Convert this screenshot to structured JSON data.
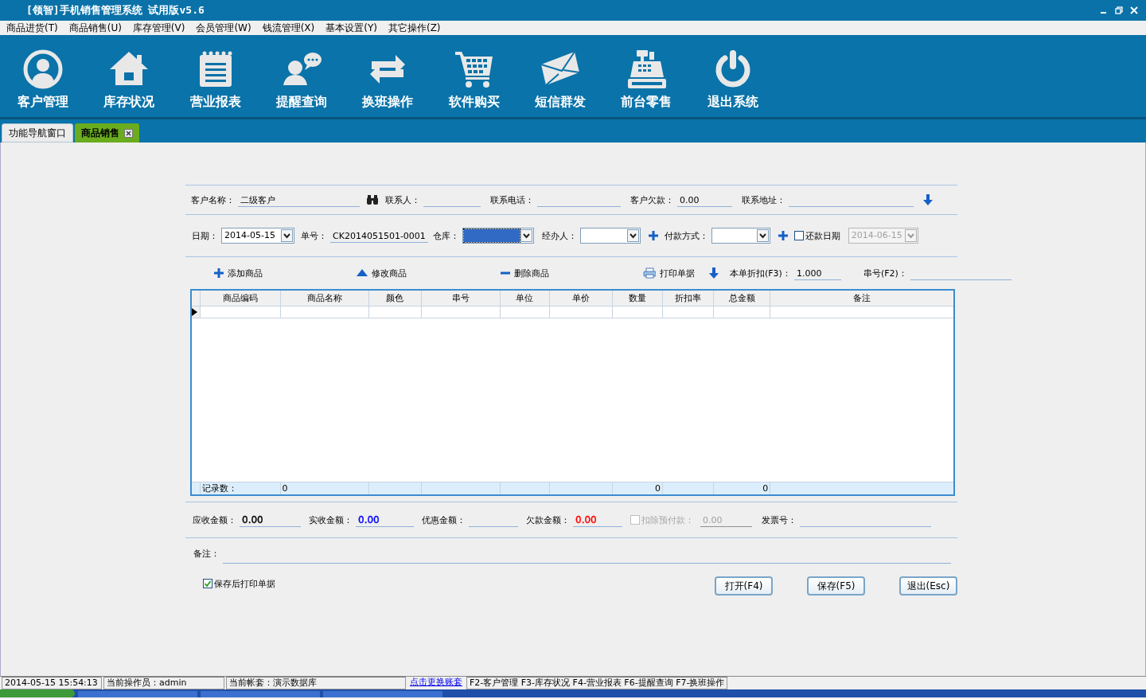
{
  "window": {
    "title": "[领智]手机销售管理系统 试用版v5.6"
  },
  "menu": [
    "商品进货(T)",
    "商品销售(U)",
    "库存管理(V)",
    "会员管理(W)",
    "钱流管理(X)",
    "基本设置(Y)",
    "其它操作(Z)"
  ],
  "toolbar": [
    {
      "label": "客户管理",
      "kind": "person"
    },
    {
      "label": "库存状况",
      "kind": "house"
    },
    {
      "label": "营业报表",
      "kind": "notepad"
    },
    {
      "label": "提醒查询",
      "kind": "chat"
    },
    {
      "label": "换班操作",
      "kind": "swap"
    },
    {
      "label": "软件购买",
      "kind": "cart"
    },
    {
      "label": "短信群发",
      "kind": "mail"
    },
    {
      "label": "前台零售",
      "kind": "register"
    },
    {
      "label": "退出系统",
      "kind": "power"
    }
  ],
  "tabs": [
    {
      "label": "功能导航窗口",
      "selected": false,
      "closable": false
    },
    {
      "label": "商品销售",
      "selected": true,
      "closable": true
    }
  ],
  "header_fields": [
    {
      "kind": "field",
      "label": "客户名称：",
      "value": "二级客户"
    },
    {
      "kind": "find"
    },
    {
      "kind": "field",
      "label": "联系人："
    },
    {
      "kind": "field",
      "label": "联系电话："
    },
    {
      "kind": "field",
      "label": "客户欠款：",
      "value": "0.00"
    },
    {
      "kind": "field",
      "label": "联系地址："
    },
    {
      "kind": "down"
    }
  ],
  "order_fields": [
    {
      "kind": "combo",
      "label": "日期：",
      "value": "2014-05-15",
      "focused": false,
      "disabled": false
    },
    {
      "kind": "field",
      "label": "单号：",
      "value": "CK2014051501-0001"
    },
    {
      "kind": "combo",
      "label": "仓库：",
      "focused": true,
      "disabled": false
    },
    {
      "kind": "combo",
      "label": "经办人：",
      "focused": false,
      "disabled": false
    },
    {
      "kind": "add"
    },
    {
      "kind": "combo",
      "label": "付款方式：",
      "focused": false,
      "disabled": false
    },
    {
      "kind": "add"
    },
    {
      "kind": "check",
      "label": "还款日期",
      "checked": false,
      "disabled": false
    },
    {
      "kind": "combo",
      "value": "2014-06-15",
      "focused": false,
      "disabled": true
    }
  ],
  "item_tools": [
    {
      "kind": "add",
      "label": "添加商品"
    },
    {
      "kind": "edit",
      "label": "修改商品"
    },
    {
      "kind": "remove",
      "label": "删除商品"
    },
    {
      "kind": "print",
      "label": "打印单据"
    },
    {
      "kind": "down"
    },
    {
      "kind": "field",
      "label": "本单折扣(F3)：",
      "value": "1.000"
    },
    {
      "kind": "field",
      "label": "串号(F2)："
    }
  ],
  "grid": {
    "columns": [
      {
        "label": "商品编码",
        "total": "记录数："
      },
      {
        "label": "商品名称",
        "total": "0"
      },
      {
        "label": "颜色"
      },
      {
        "label": "串号"
      },
      {
        "label": "单位"
      },
      {
        "label": "单价"
      },
      {
        "label": "数量",
        "total": "0"
      },
      {
        "label": "折扣率"
      },
      {
        "label": "总金额",
        "total": "0"
      },
      {
        "label": "备注"
      }
    ],
    "rows": [
      {
        "current": true
      }
    ]
  },
  "totals": [
    {
      "kind": "field",
      "label": "应收金额：",
      "value": "0.00",
      "color": "#000000"
    },
    {
      "kind": "field",
      "label": "实收金额：",
      "value": "0.00",
      "color": "#0000ff"
    },
    {
      "kind": "field",
      "label": "优惠金额："
    },
    {
      "kind": "field",
      "label": "欠款金额：",
      "value": "0.00",
      "color": "#ff0000"
    },
    {
      "kind": "check",
      "label": "扣除预付款：",
      "checked": false,
      "disabled": true
    },
    {
      "kind": "field",
      "value": "0.00",
      "disabled": true
    },
    {
      "kind": "field",
      "label": "发票号："
    }
  ],
  "note": {
    "label": "备注："
  },
  "print_after_save": {
    "label": "保存后打印单据",
    "checked": true
  },
  "buttons": [
    "打开(F4)",
    "保存(F5)",
    "退出(Esc)"
  ],
  "status_bar": [
    {
      "kind": "text",
      "text": "2014-05-15 15:54:13"
    },
    {
      "kind": "text",
      "text": "当前操作员：admin"
    },
    {
      "kind": "text",
      "text": "当前帐套：演示数据库"
    },
    {
      "kind": "link",
      "text": "点击更换账套"
    },
    {
      "kind": "text",
      "text": "F2-客户管理 F3-库存状况 F4-营业报表 F6-提醒查询 F7-换班操作"
    }
  ]
}
